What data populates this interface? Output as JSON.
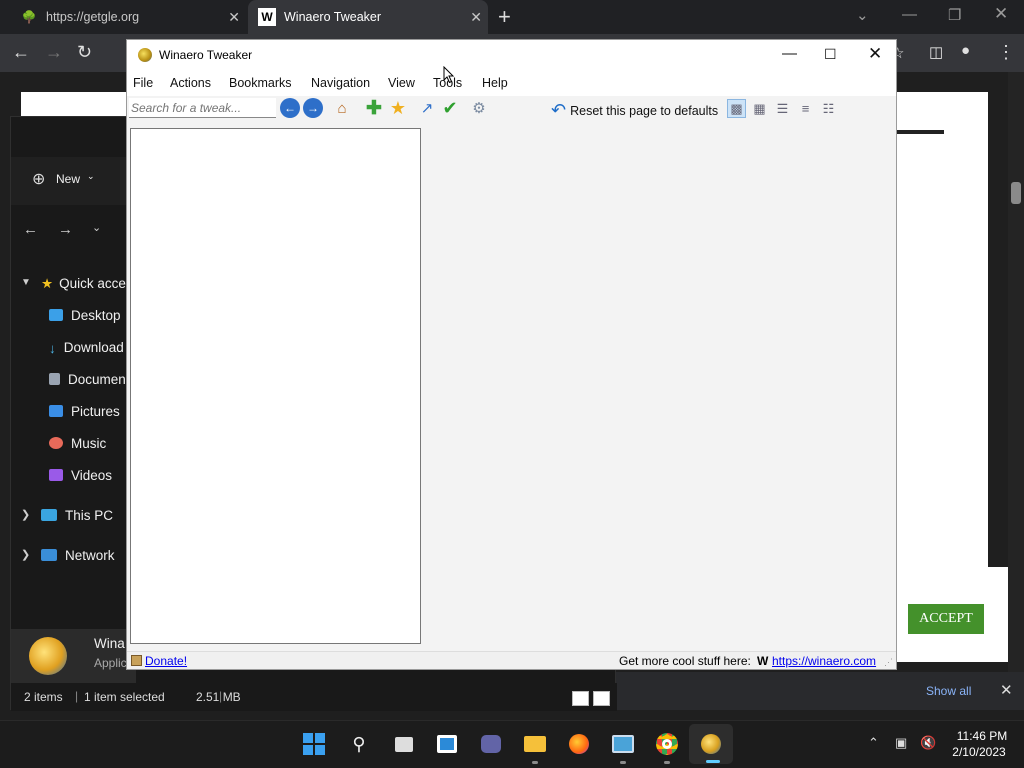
{
  "browser": {
    "tabs": [
      {
        "title": "https://getgle.org",
        "favicon": "tree-favicon"
      },
      {
        "title": "Winaero Tweaker",
        "favicon": "W"
      }
    ],
    "new_tab_glyph": "+",
    "download_bar": {
      "show_all": "Show all"
    },
    "cookie_banner": {
      "accept": "ACCEPT",
      "accept_color": "#44912b"
    }
  },
  "explorer": {
    "new_label": "New",
    "quick_access": "Quick acce",
    "nav_items": [
      {
        "label": "Desktop",
        "icon": "desktop-icon",
        "color": "#3ba0e8"
      },
      {
        "label": "Download",
        "icon": "download-icon",
        "color": "#4db6e6"
      },
      {
        "label": "Documen",
        "icon": "documents-icon",
        "color": "#9aa4b2"
      },
      {
        "label": "Pictures",
        "icon": "pictures-icon",
        "color": "#3a8ee6"
      },
      {
        "label": "Music",
        "icon": "music-icon",
        "color": "#e86a5a"
      },
      {
        "label": "Videos",
        "icon": "videos-icon",
        "color": "#9a5ae8"
      }
    ],
    "this_pc": "This PC",
    "network": "Network",
    "info_name": "Wina",
    "info_type": "Applic",
    "status": {
      "items": "2 items",
      "selected": "1 item selected",
      "size": "2.51 MB"
    }
  },
  "winaero": {
    "title": "Winaero Tweaker",
    "menu": [
      "File",
      "Actions",
      "Bookmarks",
      "Navigation",
      "View",
      "Tools",
      "Help"
    ],
    "search_placeholder": "Search for a tweak...",
    "reset_label": "Reset this page to defaults",
    "status": {
      "donate": "Donate!",
      "more": "Get more cool stuff here:",
      "w_mark": "W",
      "link": "https://winaero.com"
    }
  },
  "taskbar": {
    "time": "11:46 PM",
    "date": "2/10/2023"
  }
}
